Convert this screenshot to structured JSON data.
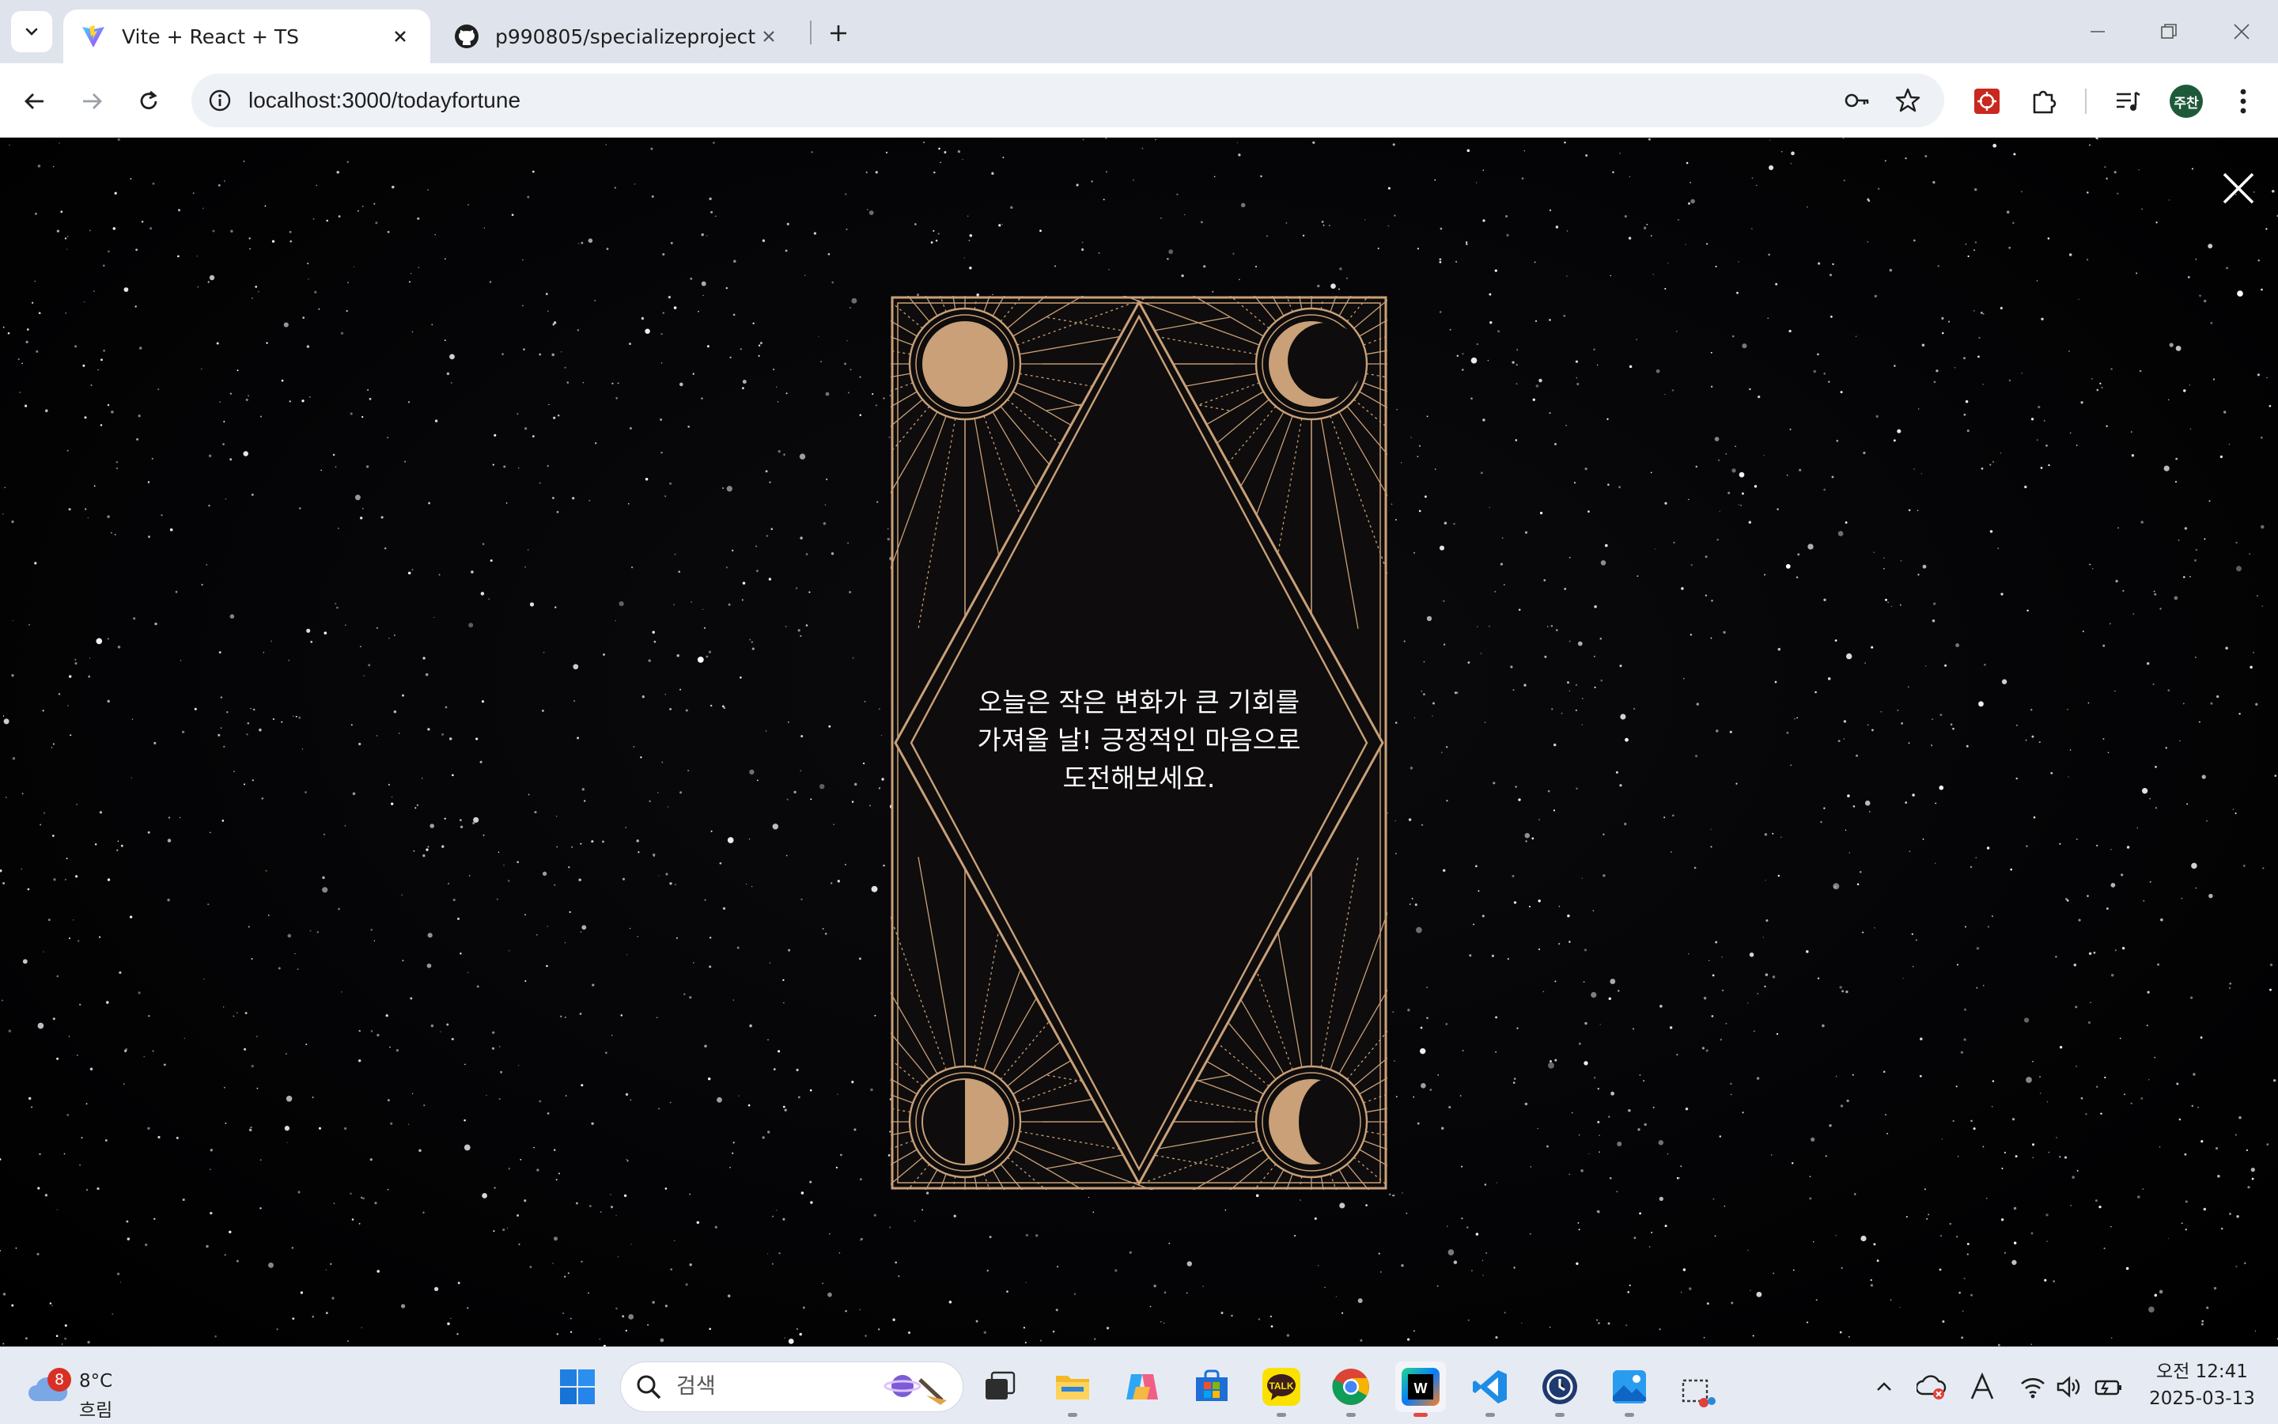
{
  "browser": {
    "tabs": [
      {
        "title": "Vite + React + TS",
        "icon": "vite-icon",
        "active": true
      },
      {
        "title": "p990805/specializeproject",
        "icon": "github-icon",
        "active": false
      }
    ],
    "url": "localhost:3000/todayfortune",
    "profile_initials": "주찬",
    "toolbar_icons": [
      "back-icon",
      "forward-icon",
      "reload-icon",
      "site-info-icon",
      "password-key-icon",
      "bookmark-star-icon",
      "extension-red-icon",
      "extensions-puzzle-icon",
      "media-control-icon",
      "profile-avatar",
      "kebab-menu-icon"
    ]
  },
  "page": {
    "fortune_text": "오늘은 작은 변화가 큰 기회를 가져올 날! 긍정적인 마음으로 도전해보세요.",
    "close_icon": "close-icon",
    "colors": {
      "card_gold": "#c9a078",
      "card_fill": "#0e0c0c",
      "background": "#000000"
    }
  },
  "taskbar": {
    "weather": {
      "temp": "8°C",
      "condition": "흐림",
      "badge": "8"
    },
    "search_placeholder": "검색",
    "apps": [
      "windows-start-icon",
      "task-view-icon",
      "file-explorer-icon",
      "copilot-icon",
      "microsoft-store-icon",
      "kakaotalk-icon",
      "chrome-icon",
      "webstorm-icon",
      "vscode-icon",
      "clock-app-icon",
      "photos-icon",
      "snipping-tool-icon"
    ],
    "kakao_label": "TALK",
    "clock": {
      "time": "오전 12:41",
      "date": "2025-03-13"
    }
  }
}
